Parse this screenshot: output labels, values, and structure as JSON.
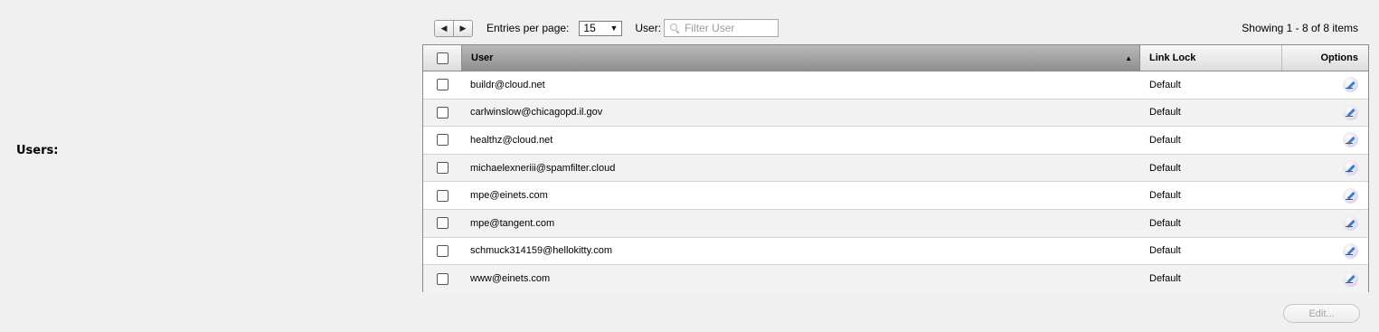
{
  "section": {
    "label": "Users:"
  },
  "toolbar": {
    "prev_icon": "triangle-left",
    "next_icon": "triangle-right",
    "entries_label": "Entries per page:",
    "entries_value": "15",
    "user_label": "User:",
    "filter_placeholder": "Filter User",
    "showing_text": "Showing 1 - 8 of 8 items"
  },
  "grid": {
    "columns": {
      "user": "User",
      "link_lock": "Link Lock",
      "options": "Options"
    },
    "sort": {
      "column": "User",
      "direction": "ascending"
    },
    "rows": [
      {
        "user": "buildr@cloud.net",
        "link_lock": "Default"
      },
      {
        "user": "carlwinslow@chicagopd.il.gov",
        "link_lock": "Default"
      },
      {
        "user": "healthz@cloud.net",
        "link_lock": "Default"
      },
      {
        "user": "michaelexneriii@spamfilter.cloud",
        "link_lock": "Default"
      },
      {
        "user": "mpe@einets.com",
        "link_lock": "Default"
      },
      {
        "user": "mpe@tangent.com",
        "link_lock": "Default"
      },
      {
        "user": "schmuck314159@hellokitty.com",
        "link_lock": "Default"
      },
      {
        "user": "www@einets.com",
        "link_lock": "Default"
      }
    ]
  },
  "footer": {
    "edit_label": "Edit..."
  },
  "colors": {
    "header_sorted": "#a6a6a6",
    "row_alt": "#f2f2f2",
    "edit_icon": "#3a7fd0"
  }
}
